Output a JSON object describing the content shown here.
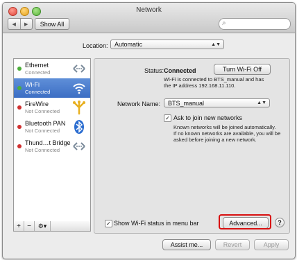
{
  "window": {
    "title": "Network"
  },
  "toolbar": {
    "back_label": "◀",
    "forward_label": "▶",
    "show_all_label": "Show All",
    "search_placeholder": ""
  },
  "location": {
    "label": "Location:",
    "value": "Automatic"
  },
  "services": [
    {
      "name": "Ethernet",
      "status": "Connected",
      "dot_color": "#4caf3a",
      "icon": "ethernet-arrows-icon"
    },
    {
      "name": "Wi-Fi",
      "status": "Connected",
      "dot_color": "#4caf3a",
      "icon": "wifi-icon"
    },
    {
      "name": "FireWire",
      "status": "Not Connected",
      "dot_color": "#d03030",
      "icon": "firewire-icon"
    },
    {
      "name": "Bluetooth PAN",
      "status": "Not Connected",
      "dot_color": "#d03030",
      "icon": "bluetooth-icon"
    },
    {
      "name": "Thund…t Bridge",
      "status": "Not Connected",
      "dot_color": "#d03030",
      "icon": "thunderbolt-arrows-icon"
    }
  ],
  "sidebar_controls": {
    "add": "+",
    "remove": "−",
    "action": "⚙▾"
  },
  "detail": {
    "status_label": "Status:",
    "status_value": "Connected",
    "turn_off_button": "Turn Wi-Fi Off",
    "status_desc_1": "Wi-Fi is connected to BTS_manual and has",
    "status_desc_2": "the IP address 192.168.11.110.",
    "network_name_label": "Network Name:",
    "network_name_value": "BTS_manual",
    "ask_join_label": "Ask to join new networks",
    "ask_join_checked": "✓",
    "ask_desc_1": "Known networks will be joined automatically.",
    "ask_desc_2": "If no known networks are available, you will be",
    "ask_desc_3": "asked before joining a new network."
  },
  "show_status": {
    "label": "Show Wi-Fi status in menu bar",
    "checked": "✓"
  },
  "advanced_button": "Advanced...",
  "help_button": "?",
  "footer": {
    "assist": "Assist me...",
    "revert": "Revert",
    "apply": "Apply"
  },
  "colors": {
    "selection": "#3c6ec4",
    "highlight_box": "#d81010"
  }
}
